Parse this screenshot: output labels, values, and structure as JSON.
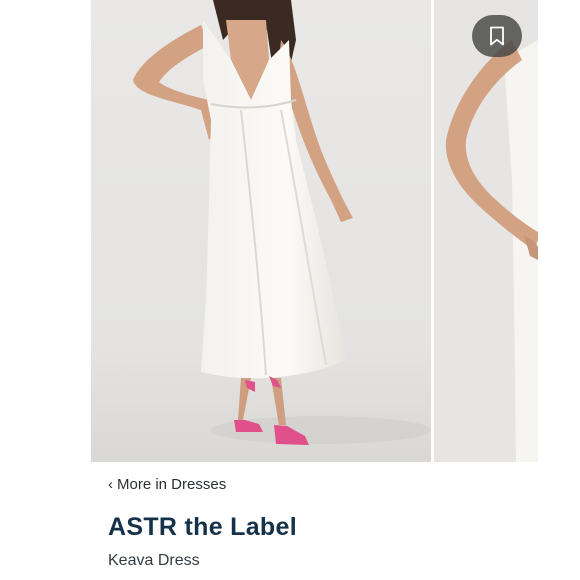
{
  "gallery": {
    "images": [
      {
        "subject": "model-in-white-halter-dress"
      },
      {
        "subject": "model-arm-crop"
      }
    ],
    "save_icon": "bookmark-icon"
  },
  "breadcrumb": {
    "chevron": "‹",
    "label": "More in Dresses"
  },
  "product": {
    "brand": "ASTR the Label",
    "name": "Keava Dress"
  },
  "colors": {
    "brand_text": "#16324a",
    "save_button_bg": "#464646",
    "shoe_accent": "#e0508a"
  }
}
